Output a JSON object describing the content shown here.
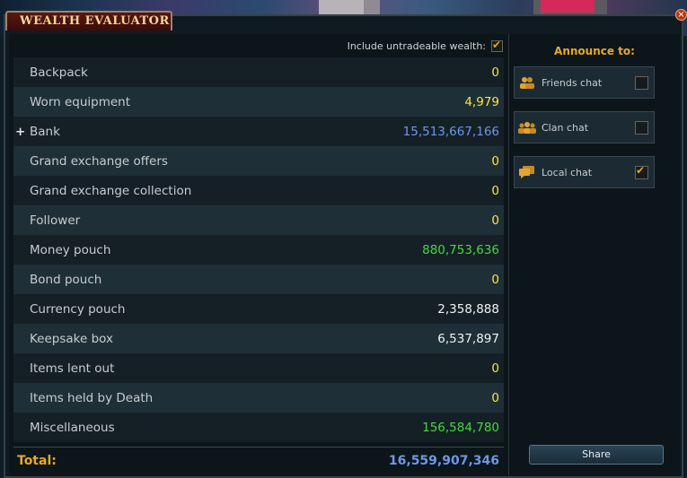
{
  "window": {
    "title": "WEALTH EVALUATOR",
    "close_glyph": "×"
  },
  "untradeable": {
    "label": "Include untradeable wealth:",
    "checked": true
  },
  "rows": [
    {
      "label": "Backpack",
      "value": "0",
      "color": "yellow"
    },
    {
      "label": "Worn equipment",
      "value": "4,979",
      "color": "yellow"
    },
    {
      "label": "Bank",
      "value": "15,513,667,166",
      "color": "blue",
      "expand": "+"
    },
    {
      "label": "Grand exchange offers",
      "value": "0",
      "color": "yellow"
    },
    {
      "label": "Grand exchange collection",
      "value": "0",
      "color": "yellow"
    },
    {
      "label": "Follower",
      "value": "0",
      "color": "yellow"
    },
    {
      "label": "Money pouch",
      "value": "880,753,636",
      "color": "green"
    },
    {
      "label": "Bond pouch",
      "value": "0",
      "color": "yellow"
    },
    {
      "label": "Currency pouch",
      "value": "2,358,888",
      "color": "white"
    },
    {
      "label": "Keepsake box",
      "value": "6,537,897",
      "color": "white"
    },
    {
      "label": "Items lent out",
      "value": "0",
      "color": "yellow"
    },
    {
      "label": "Items held by Death",
      "value": "0",
      "color": "yellow"
    },
    {
      "label": "Miscellaneous",
      "value": "156,584,780",
      "color": "green"
    }
  ],
  "total": {
    "label": "Total:",
    "value": "16,559,907,346"
  },
  "announce": {
    "title": "Announce to:",
    "options": [
      {
        "label": "Friends chat",
        "icon": "friends-icon",
        "checked": false
      },
      {
        "label": "Clan chat",
        "icon": "clan-icon",
        "checked": false
      },
      {
        "label": "Local chat",
        "icon": "local-chat-icon",
        "checked": true
      }
    ],
    "share_label": "Share"
  },
  "colors": {
    "yellow": "#f6e640",
    "blue": "#6f97e6",
    "green": "#45d93c",
    "white": "#f1f3f4",
    "accent": "#e9a82a"
  }
}
